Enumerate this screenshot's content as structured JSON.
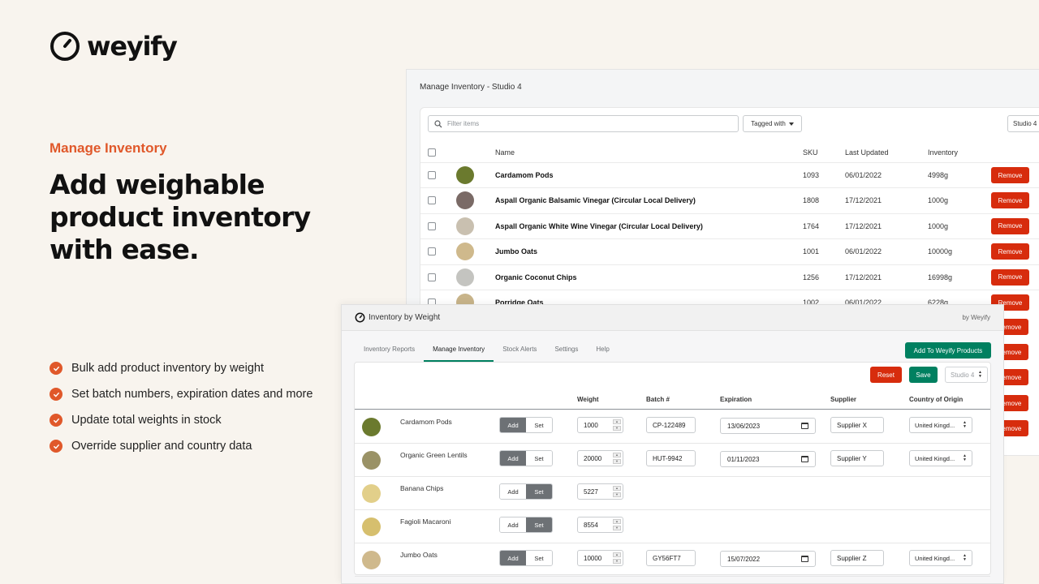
{
  "brand": {
    "name": "weyify",
    "accent": "#e0582a"
  },
  "hero": {
    "eyebrow": "Manage Inventory",
    "headline": "Add weighable product inventory with ease.",
    "features": [
      "Bulk add product inventory by weight",
      "Set batch numbers, expiration dates and more",
      "Update total weights in stock",
      "Override supplier and country data"
    ]
  },
  "back_panel": {
    "title": "Manage Inventory - Studio 4",
    "filter_placeholder": "Filter items",
    "tagged_label": "Tagged with",
    "location_label": "Studio 4",
    "columns": {
      "name": "Name",
      "sku": "SKU",
      "updated": "Last Updated",
      "inventory": "Inventory"
    },
    "remove_label": "Remove",
    "rows": [
      {
        "name": "Cardamom Pods",
        "sku": "1093",
        "updated": "06/01/2022",
        "inventory": "4998g",
        "color": "#6b7a2e"
      },
      {
        "name": "Aspall Organic Balsamic Vinegar (Circular Local Delivery)",
        "sku": "1808",
        "updated": "17/12/2021",
        "inventory": "1000g",
        "color": "#7a6a66"
      },
      {
        "name": "Aspall Organic White Wine Vinegar (Circular Local Delivery)",
        "sku": "1764",
        "updated": "17/12/2021",
        "inventory": "1000g",
        "color": "#c9c0b0"
      },
      {
        "name": "Jumbo Oats",
        "sku": "1001",
        "updated": "06/01/2022",
        "inventory": "10000g",
        "color": "#cfb98c"
      },
      {
        "name": "Organic Coconut Chips",
        "sku": "1256",
        "updated": "17/12/2021",
        "inventory": "16998g",
        "color": "#c4c4c0"
      },
      {
        "name": "Porridge Oats",
        "sku": "1002",
        "updated": "06/01/2022",
        "inventory": "6228g",
        "color": "#c8b48a"
      }
    ]
  },
  "front_panel": {
    "app_name": "Inventory by Weight",
    "byline": "by Weyify",
    "tabs": [
      "Inventory Reports",
      "Manage Inventory",
      "Stock Alerts",
      "Settings",
      "Help"
    ],
    "active_tab": "Manage Inventory",
    "add_button": "Add To Weyify Products",
    "reset_label": "Reset",
    "save_label": "Save",
    "location_label": "Studio 4",
    "columns": {
      "weight": "Weight",
      "batch": "Batch #",
      "expiration": "Expiration",
      "supplier": "Supplier",
      "country": "Country of Origin"
    },
    "add_label": "Add",
    "set_label": "Set",
    "rows": [
      {
        "name": "Cardamom Pods",
        "mode": "Add",
        "weight": "1000",
        "batch": "CP-122489",
        "expiration": "13/06/2023",
        "supplier": "Supplier X",
        "country": "United Kingd...",
        "color": "#6b7a2e"
      },
      {
        "name": "Organic Green Lentils",
        "mode": "Add",
        "weight": "20000",
        "batch": "HUT-9942",
        "expiration": "01/11/2023",
        "supplier": "Supplier Y",
        "country": "United Kingd...",
        "color": "#9a9266"
      },
      {
        "name": "Banana Chips",
        "mode": "Set",
        "weight": "5227",
        "color": "#e2cf8a"
      },
      {
        "name": "Fagioli Macaroni",
        "mode": "Set",
        "weight": "8554",
        "color": "#d6bf6e"
      },
      {
        "name": "Jumbo Oats",
        "mode": "Add",
        "weight": "10000",
        "batch": "GY56FT7",
        "expiration": "15/07/2022",
        "supplier": "Supplier Z",
        "country": "United Kingd...",
        "color": "#cfb98c"
      }
    ]
  }
}
